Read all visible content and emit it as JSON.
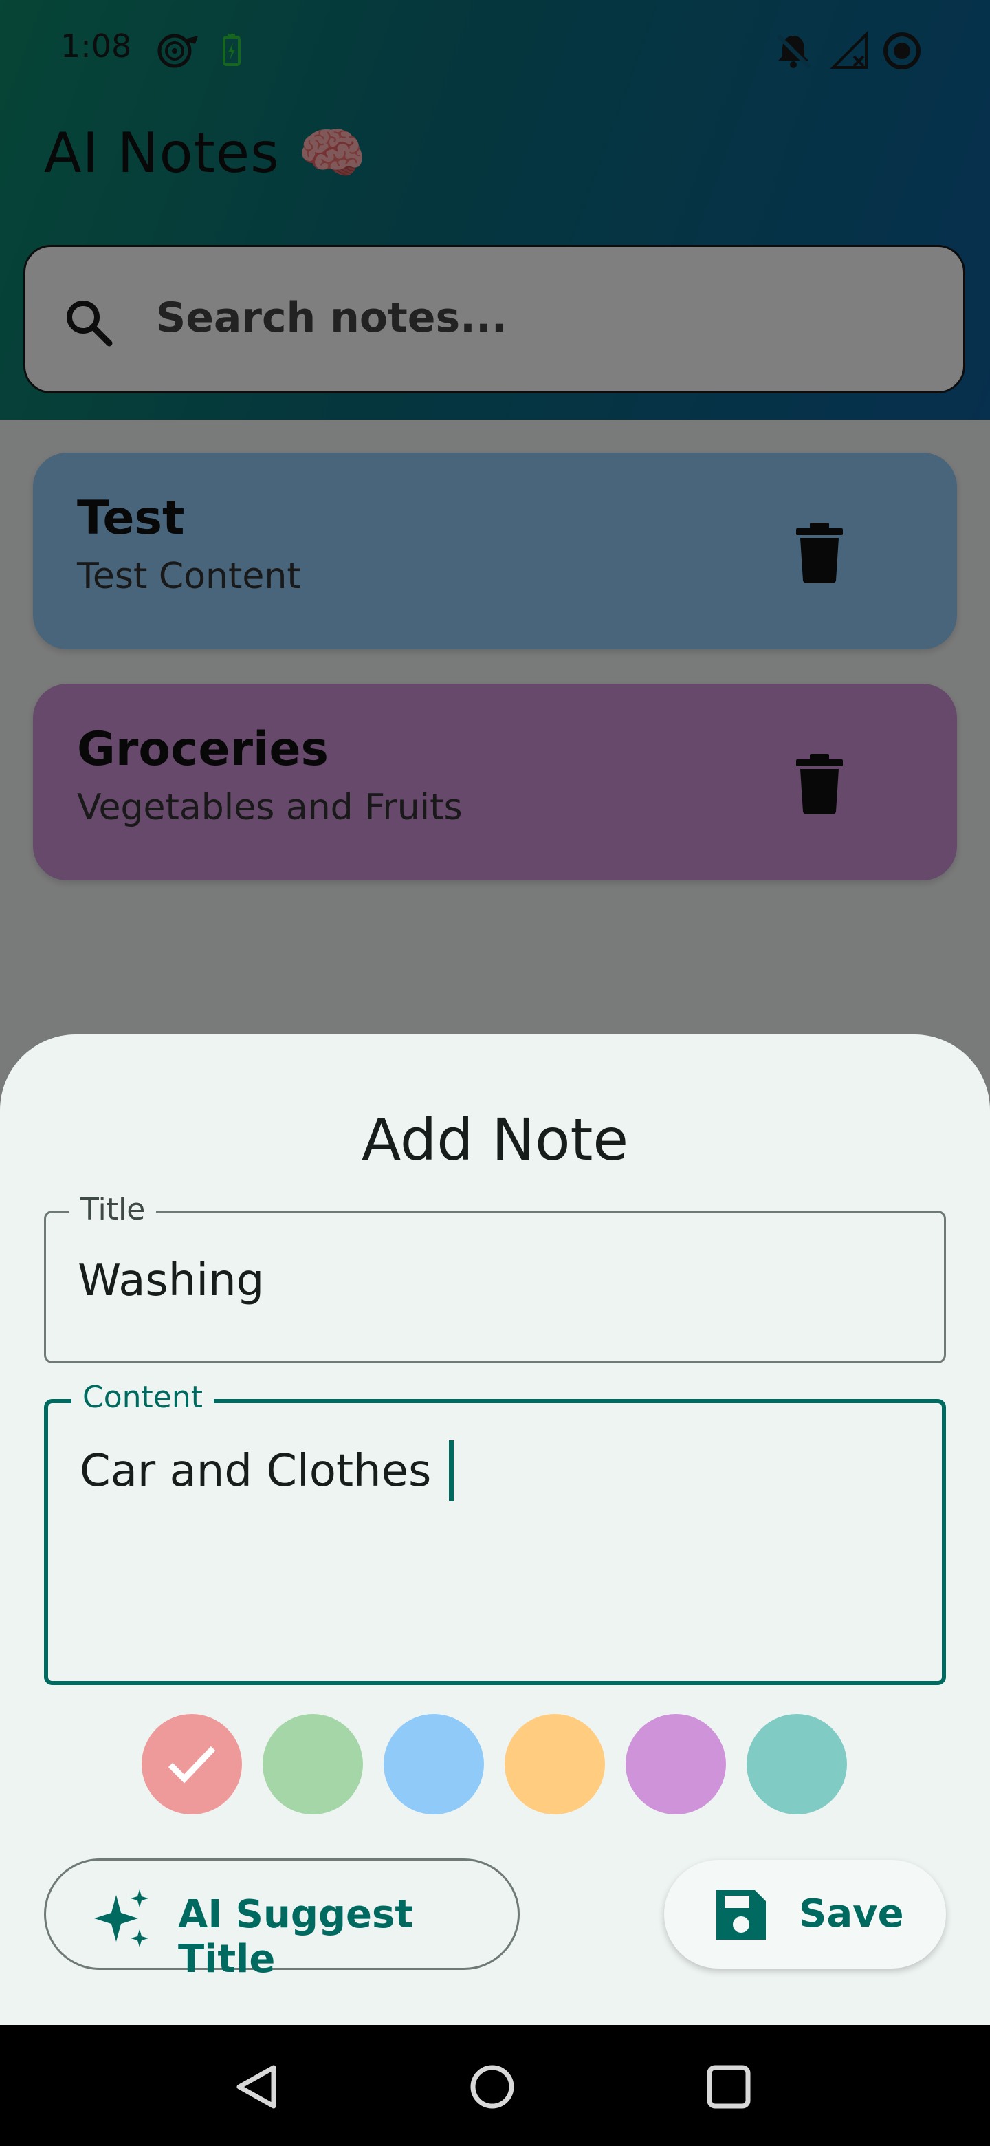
{
  "status_bar": {
    "time": "1:08",
    "icons": [
      "radar-icon",
      "battery-charging-icon",
      "bell-off-icon",
      "no-signal-icon",
      "sync-circle-icon"
    ]
  },
  "app": {
    "title": "AI Notes 🧠"
  },
  "search": {
    "placeholder": "Search notes..."
  },
  "notes": [
    {
      "title": "Test",
      "content": "Test Content",
      "color": "#90CAF9"
    },
    {
      "title": "Groceries",
      "content": "Vegetables and Fruits",
      "color": "#CE93D8"
    }
  ],
  "sheet": {
    "title": "Add Note",
    "title_field": {
      "label": "Title",
      "value": "Washing"
    },
    "content_field": {
      "label": "Content",
      "value": "Car and Clothes"
    },
    "colors": [
      "#EF9A9A",
      "#A5D6A7",
      "#90CAF9",
      "#FFCC80",
      "#CE93D8",
      "#80CBC4"
    ],
    "selected_color": "#EF9A9A",
    "ai_button_label": "AI Suggest Title",
    "save_button_label": "Save"
  },
  "theme": {
    "accent": "#006A60",
    "header_gradient": [
      "#0E8A6C",
      "#0E5F9C"
    ]
  }
}
